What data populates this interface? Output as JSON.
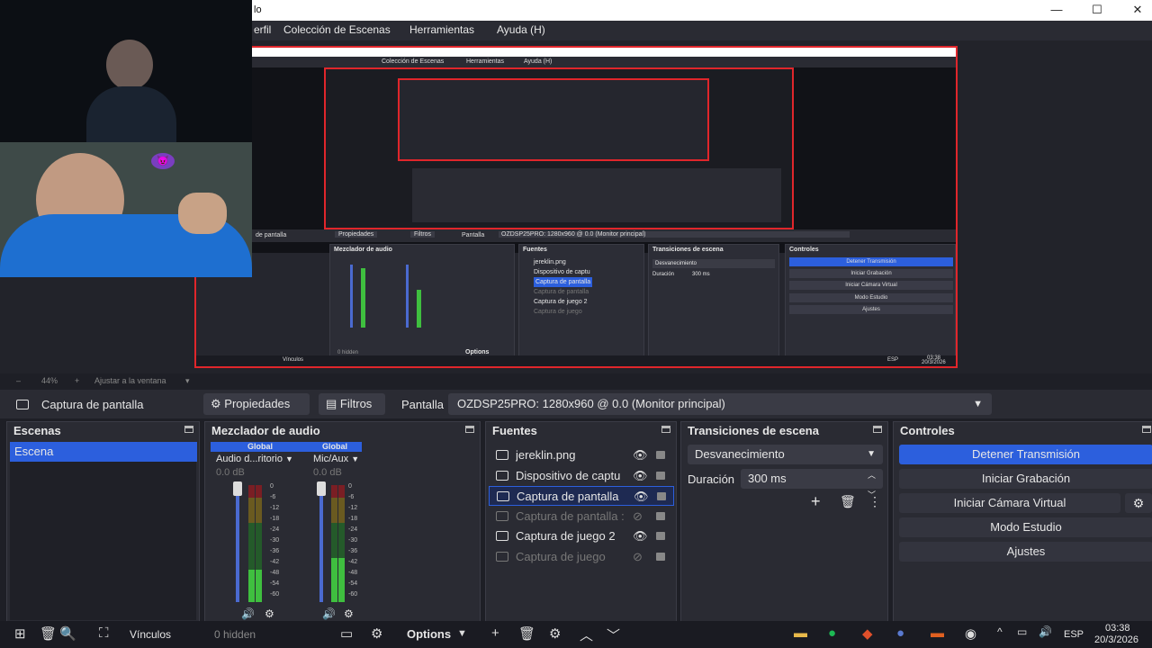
{
  "window": {
    "title": "lo",
    "minimize": "—",
    "maximize": "☐",
    "close": "✕"
  },
  "menu": {
    "items": [
      "erfil",
      "Colección de Escenas",
      "Herramientas",
      "Ayuda (H)"
    ]
  },
  "preview_nested": {
    "menu_items": [
      "Colección de Escenas",
      "Herramientas",
      "Ayuda (H)"
    ],
    "source_bar": "de pantalla",
    "propiedades": "Propiedades",
    "filtros": "Filtros",
    "pantalla": "Pantalla",
    "monitor": "OZDSP25PRO: 1280x960 @ 0.0 (Monitor principal)",
    "mixer_title": "Mezclador de audio",
    "sources_title": "Fuentes",
    "transitions_title": "Transiciones de escena",
    "controls_title": "Controles",
    "sources": [
      "jereklin.png",
      "Dispositivo de captu",
      "Captura de pantalla",
      "Captura de pantalla",
      "Captura de juego 2",
      "Captura de juego"
    ],
    "transition": "Desvanecimiento",
    "duration_label": "Duración",
    "duration": "300 ms",
    "controls": [
      "Detener Transmisión",
      "Iniciar Grabación",
      "Iniciar Cámara Virtual",
      "Modo Estudio",
      "Ajustes"
    ],
    "time": "03:38",
    "date": "20/3/2026",
    "lang": "ESP",
    "hidden": "0 hidden",
    "options": "Options",
    "vinculos": "Vínculos"
  },
  "webcam": {
    "emoji": "😈"
  },
  "zoombar": {
    "minus": "–",
    "zoom": "44%",
    "plus": "+",
    "fit": "Ajustar a la ventana"
  },
  "sourcebar": {
    "source_name": "Captura de pantalla",
    "properties": "Propiedades",
    "filters": "Filtros",
    "screen_label": "Pantalla",
    "screen_value": "OZDSP25PRO: 1280x960 @ 0.0 (Monitor principal)"
  },
  "scenes": {
    "title": "Escenas",
    "items": [
      "Escena"
    ]
  },
  "mixer": {
    "title": "Mezclador de audio",
    "channels": [
      {
        "header": "Global",
        "name": "Audio d...ritorio",
        "db": "0.0 dB",
        "level": 0.28
      },
      {
        "header": "Global",
        "name": "Mic/Aux",
        "db": "0.0 dB",
        "level": 0.38
      }
    ],
    "scale": [
      "0",
      "-6",
      "-12",
      "-18",
      "-24",
      "-30",
      "-36",
      "-42",
      "-48",
      "-54",
      "-60"
    ]
  },
  "sources": {
    "title": "Fuentes",
    "items": [
      {
        "label": "jereklin.png",
        "visible": true,
        "selected": false,
        "dim": false
      },
      {
        "label": "Dispositivo de captu",
        "visible": true,
        "selected": false,
        "dim": false
      },
      {
        "label": "Captura de pantalla",
        "visible": true,
        "selected": true,
        "dim": false
      },
      {
        "label": "Captura de pantalla :",
        "visible": false,
        "selected": false,
        "dim": true
      },
      {
        "label": "Captura de juego 2",
        "visible": true,
        "selected": false,
        "dim": false
      },
      {
        "label": "Captura de juego",
        "visible": false,
        "selected": false,
        "dim": true
      }
    ]
  },
  "transitions": {
    "title": "Transiciones de escena",
    "selected": "Desvanecimiento",
    "duration_label": "Duración",
    "duration_value": "300 ms"
  },
  "controls": {
    "title": "Controles",
    "stop_stream": "Detener Transmisión",
    "start_record": "Iniciar Grabación",
    "virtual_cam": "Iniciar Cámara Virtual",
    "studio_mode": "Modo Estudio",
    "settings": "Ajustes"
  },
  "footer": {
    "hidden": "0 hidden",
    "options": "Options",
    "vinculos": "Vínculos"
  },
  "tray": {
    "lang": "ESP",
    "time": "03:38",
    "date": "20/3/2026"
  },
  "colors": {
    "accent": "#2c5fdd",
    "preview_border": "#e0262b",
    "panel": "#2a2b33",
    "background": "#1e1f26"
  }
}
